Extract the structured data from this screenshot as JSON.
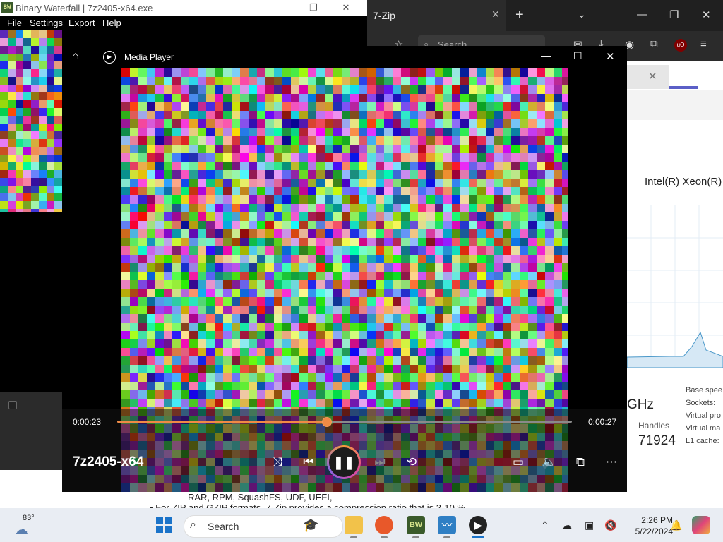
{
  "binary_waterfall": {
    "title": "Binary Waterfall | 7z2405-x64.exe",
    "logo_text": "BW",
    "menu": [
      "File",
      "Settings",
      "Export",
      "Help"
    ]
  },
  "browser": {
    "tab_title": "7-Zip",
    "search_placeholder": "Search",
    "cpu_name": "Intel(R) Xeon(R)",
    "ghz_text": "GHz",
    "handles_label": "Handles",
    "handles_value": "71924",
    "specs": [
      "Base spee",
      "Sockets:",
      "Virtual pro",
      "Virtual ma",
      "L1 cache:"
    ],
    "article_lines": [
      "RAR, RPM, SquashFS, UDF, UEFI,",
      "• For ZIP and GZIP formats, 7-Zip provides a compression ratio that is 2-10 %"
    ]
  },
  "media_player": {
    "title": "Media Player",
    "current_time": "0:00:23",
    "total_time": "0:00:27",
    "progress": 0.46,
    "media_name": "7z2405-x64"
  },
  "taskbar": {
    "weather_temp": "83°",
    "search_label": "Search",
    "time": "2:26 PM",
    "date": "5/22/2024"
  },
  "colors": {
    "accent_orange": "#f08a45",
    "start_blue": "#1a73c9"
  }
}
